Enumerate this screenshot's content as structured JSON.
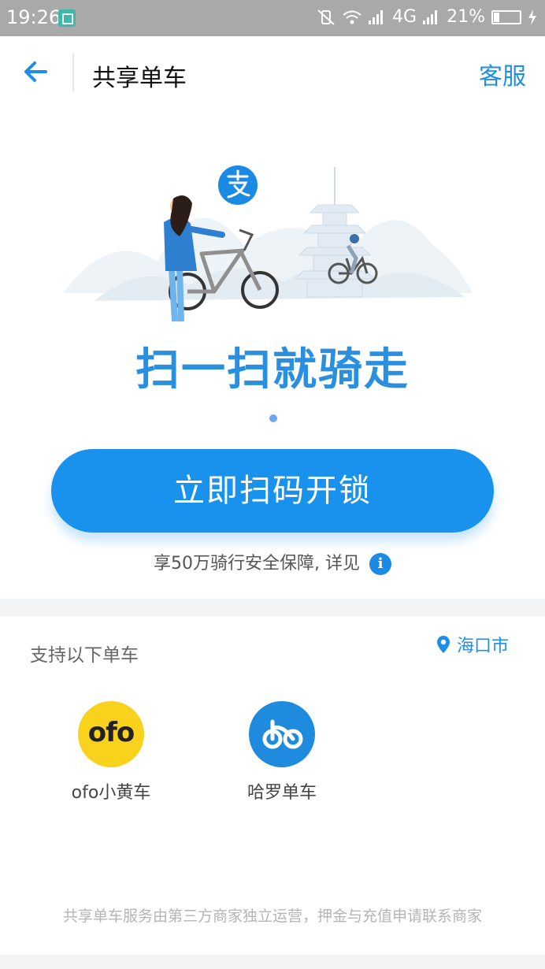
{
  "status_bar": {
    "time": "19:26",
    "network": "4G",
    "battery": "21%",
    "battery_level": 0.21
  },
  "nav": {
    "title": "共享单车",
    "service_label": "客服"
  },
  "hero": {
    "headline": "扫一扫就骑走",
    "cta_label": "立即扫码开锁",
    "insurance_note": "享50万骑行安全保障, 详见"
  },
  "supported": {
    "label": "支持以下单车",
    "city": "海口市",
    "brands": [
      {
        "logo_text": "ofo",
        "name": "ofo小黄车"
      },
      {
        "name": "哈罗单车"
      }
    ]
  },
  "disclaimer": "共享单车服务由第三方商家独立运营，押金与充值申请联系商家",
  "colors": {
    "accent": "#1892ec",
    "ofo_yellow": "#f8d21c",
    "hello_blue": "#1f8bde"
  },
  "icons": [
    "back-arrow-icon",
    "info-icon",
    "location-pin-icon",
    "alipay-icon"
  ]
}
